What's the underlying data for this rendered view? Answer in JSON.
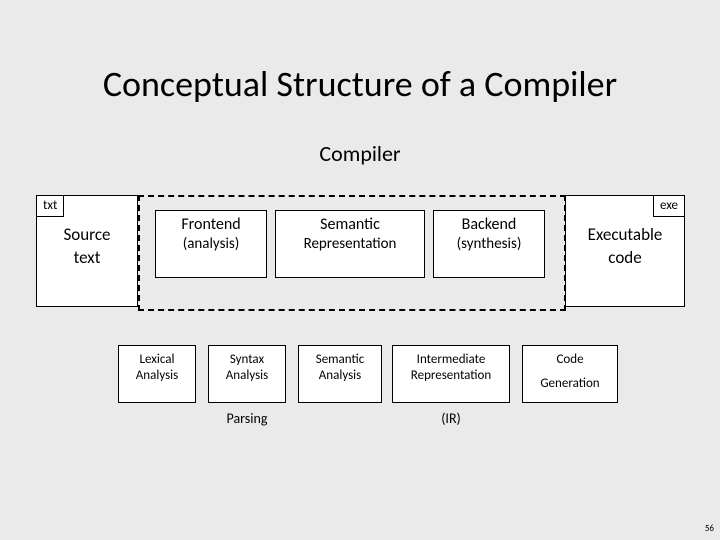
{
  "title": "Conceptual Structure of a Compiler",
  "subtitle": "Compiler",
  "source": {
    "tag": "txt",
    "line1": "Source",
    "line2": "text"
  },
  "exec": {
    "tag": "exe",
    "line1": "Executable",
    "line2": "code"
  },
  "stages": {
    "frontend": {
      "line1": "Frontend",
      "line2": "(analysis)"
    },
    "semantic": {
      "line1": "Semantic",
      "line2": "Representation"
    },
    "backend": {
      "line1": "Backend",
      "line2": "(synthesis)"
    }
  },
  "details": {
    "lexical": {
      "l1": "Lexical",
      "l2": "Analysis"
    },
    "syntax": {
      "l1": "Syntax",
      "l2": "Analysis"
    },
    "semanal": {
      "l1": "Semantic",
      "l2": "Analysis"
    },
    "ir": {
      "l1": "Intermediate",
      "l2": "Representation"
    },
    "codegen": {
      "l1": "Code",
      "l2": "Generation"
    }
  },
  "below": {
    "parsing": "Parsing",
    "ir": "(IR)"
  },
  "pagenum": "56"
}
